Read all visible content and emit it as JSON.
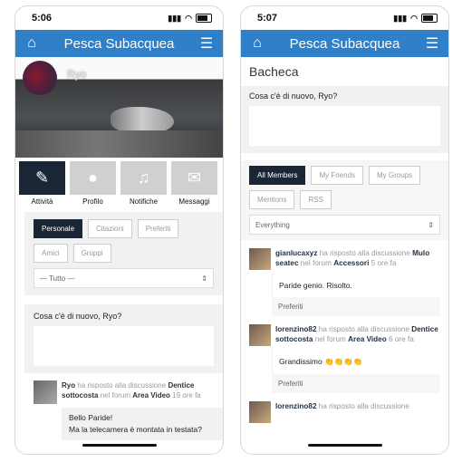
{
  "left": {
    "time": "5:06",
    "app_title": "Pesca Subacquea",
    "profile_name": "Ryo",
    "tabs": [
      "Attività",
      "Profilo",
      "Notifiche",
      "Messaggi"
    ],
    "filters": [
      "Personale",
      "Citazioni",
      "Preferiti",
      "Amici",
      "Gruppi"
    ],
    "select_value": "— Tutto —",
    "status_prompt": "Cosa c'è di nuovo, Ryo?",
    "activity": {
      "author": "Ryo",
      "action": "ha risposto alla discussione",
      "topic": "Dentice sottocosta",
      "forum_prefix": "nel forum",
      "forum": "Area Video",
      "time": "19 ore fa",
      "body_line1": "Bello Paride!",
      "body_line2": "Ma la telecamera è montata in testata?"
    }
  },
  "right": {
    "time": "5:07",
    "app_title": "Pesca Subacquea",
    "section_title": "Bacheca",
    "status_prompt": "Cosa c'è di nuovo, Ryo?",
    "filters": [
      "All Members",
      "My Friends",
      "My Groups",
      "Mentions",
      "RSS"
    ],
    "select_value": "Everything",
    "feed": [
      {
        "author": "gianlucaxyz",
        "action": "ha risposto alla discussione",
        "topic": "Mulo seatec",
        "forum_prefix": "nel forum",
        "forum": "Accessori",
        "time": "5 ore fa",
        "message": "Paride genio. Risolto.",
        "fav_label": "Preferiti"
      },
      {
        "author": "lorenzino82",
        "action": "ha risposto alla discussione",
        "topic": "Dentice sottocosta",
        "forum_prefix": "nel forum",
        "forum": "Area Video",
        "time": "6 ore fa",
        "message": "Grandissimo 👏👏👏👏",
        "fav_label": "Preferiti"
      },
      {
        "author": "lorenzino82",
        "action": "ha risposto alla discussione"
      }
    ]
  },
  "colors": {
    "appbar": "#2f80c9",
    "active_tab": "#1a2536",
    "panel": "#f1f1f1"
  },
  "icons": [
    "home-icon",
    "list-menu-icon",
    "pencil-icon",
    "user-icon",
    "bell-icon",
    "envelope-icon",
    "select-arrows-icon"
  ]
}
